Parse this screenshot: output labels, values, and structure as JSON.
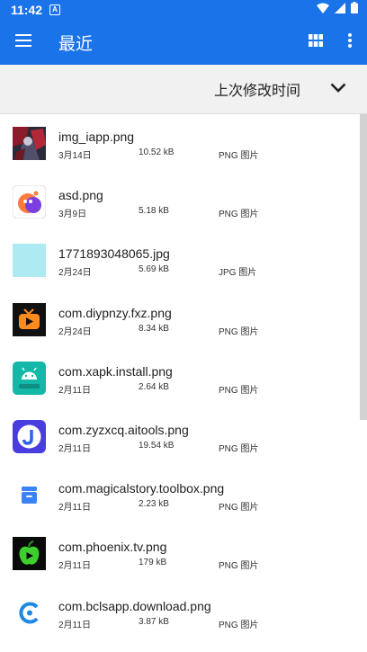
{
  "status": {
    "time": "11:42",
    "notif_letter": "A"
  },
  "appbar": {
    "title": "最近",
    "menu_icon": "hamburger-menu-icon",
    "grid_icon": "grid-view-icon",
    "more_icon": "more-vert-icon",
    "color": "#1a73e8"
  },
  "sort": {
    "label": "上次修改时间",
    "icon": "chevron-down-icon"
  },
  "files": [
    {
      "name": "img_iapp.png",
      "date": "3月14日",
      "size": "10.52 kB",
      "type": "PNG 图片",
      "icon": "image-thumbnail"
    },
    {
      "name": "asd.png",
      "date": "3月9日",
      "size": "5.18 kB",
      "type": "PNG 图片",
      "icon": "app-logo-thumbnail"
    },
    {
      "name": "1771893048065.jpg",
      "date": "2月24日",
      "size": "5.69 kB",
      "type": "JPG 图片",
      "icon": "light-blue-thumbnail"
    },
    {
      "name": "com.diypnzy.fxz.png",
      "date": "2月24日",
      "size": "8.34 kB",
      "type": "PNG 图片",
      "icon": "tv-app-thumbnail"
    },
    {
      "name": "com.xapk.install.png",
      "date": "2月11日",
      "size": "2.64 kB",
      "type": "PNG 图片",
      "icon": "android-app-thumbnail"
    },
    {
      "name": "com.zyzxcq.aitools.png",
      "date": "2月11日",
      "size": "19.54 kB",
      "type": "PNG 图片",
      "icon": "j-app-thumbnail"
    },
    {
      "name": "com.magicalstory.toolbox.png",
      "date": "2月11日",
      "size": "2.23 kB",
      "type": "PNG 图片",
      "icon": "toolbox-app-thumbnail"
    },
    {
      "name": "com.phoenix.tv.png",
      "date": "2月11日",
      "size": "179 kB",
      "type": "PNG 图片",
      "icon": "apple-tv-thumbnail"
    },
    {
      "name": "com.bclsapp.download.png",
      "date": "2月11日",
      "size": "3.87 kB",
      "type": "PNG 图片",
      "icon": "download-app-thumbnail"
    }
  ]
}
